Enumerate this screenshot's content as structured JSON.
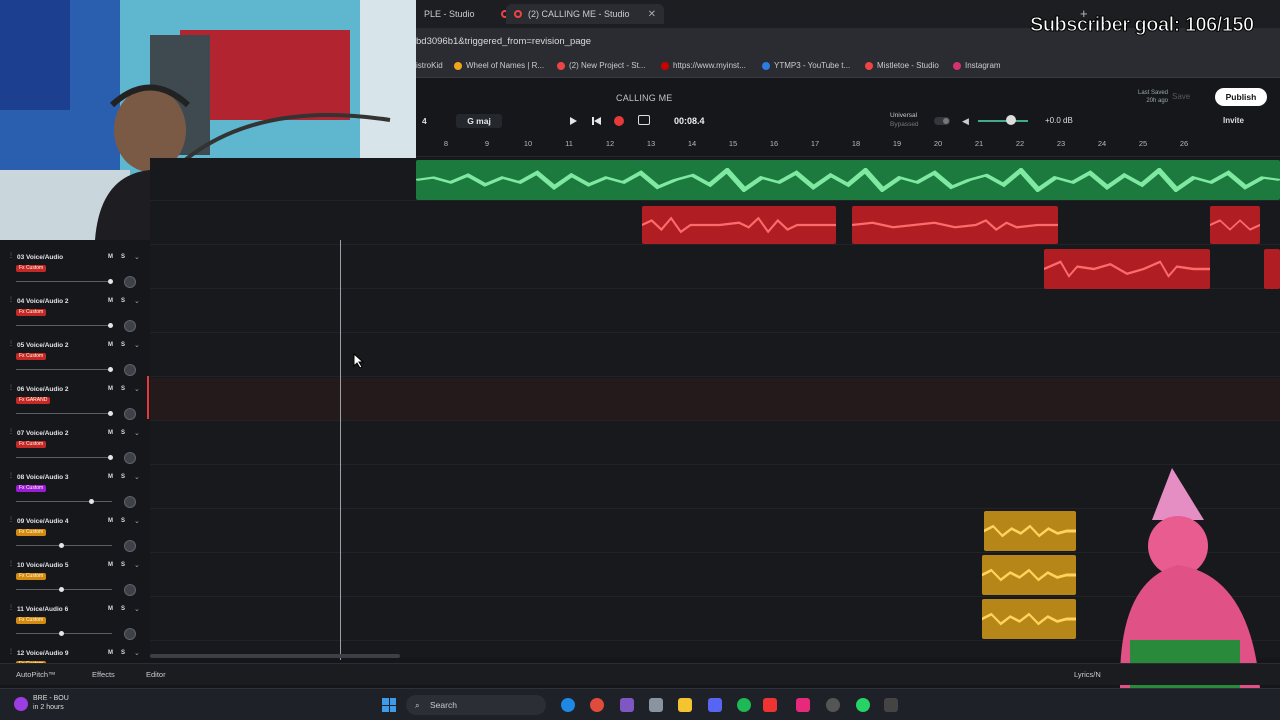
{
  "browser": {
    "tabs": [
      {
        "label": "PLE - Studio",
        "active": false
      },
      {
        "label": "(2) CALLING ME - Studio",
        "active": true
      }
    ],
    "address": "bd3096b1&triggered_from=revision_page",
    "bookmarks": [
      {
        "label": "istroKid",
        "color": "#6a6a6a"
      },
      {
        "label": "Wheel of Names | R...",
        "color": "#f2a51a"
      },
      {
        "label": "(2) New Project - St...",
        "color": "#e44"
      },
      {
        "label": "https://www.myinst...",
        "color": "#c00"
      },
      {
        "label": "YTMP3 - YouTube t...",
        "color": "#2a7de1"
      },
      {
        "label": "Mistletoe - Studio",
        "color": "#e44"
      },
      {
        "label": "Instagram",
        "color": "#d6336c"
      }
    ]
  },
  "overlay": {
    "subscriber_goal": "Subscriber goal: 106/150"
  },
  "studio": {
    "project_title": "CALLING ME",
    "bpm_fragment": "4",
    "key": "G maj",
    "time": "00:08.4",
    "universal_label": "Universal",
    "bypassed_label": "Bypassed",
    "gain": "+0.0 dB",
    "last_saved_label": "Last Saved",
    "last_saved_time": "20h ago",
    "save_label": "Save",
    "publish_label": "Publish",
    "invite_label": "Invite",
    "ruler_ticks": [
      "8",
      "9",
      "10",
      "11",
      "12",
      "13",
      "14",
      "15",
      "16",
      "17",
      "18",
      "19",
      "20",
      "21",
      "22",
      "23",
      "24",
      "25",
      "26"
    ],
    "tracks": [
      {
        "number": "03",
        "name": "Voice/Audio",
        "fx": "Fx Custom",
        "fx_color": "#c62828",
        "fader": 0.98,
        "selected": false
      },
      {
        "number": "04",
        "name": "Voice/Audio 2",
        "fx": "Fx Custom",
        "fx_color": "#c62828",
        "fader": 0.98,
        "selected": false
      },
      {
        "number": "05",
        "name": "Voice/Audio 2",
        "fx": "Fx Custom",
        "fx_color": "#c62828",
        "fader": 0.98,
        "selected": false
      },
      {
        "number": "06",
        "name": "Voice/Audio 2",
        "fx": "Fx GARAND",
        "fx_color": "#c62828",
        "fader": 0.98,
        "selected": true
      },
      {
        "number": "07",
        "name": "Voice/Audio 2",
        "fx": "Fx Custom",
        "fx_color": "#c62828",
        "fader": 0.98,
        "selected": false
      },
      {
        "number": "08",
        "name": "Voice/Audio 3",
        "fx": "Fx Custom",
        "fx_color": "#9b1bd8",
        "fader": 0.78,
        "selected": false
      },
      {
        "number": "09",
        "name": "Voice/Audio 4",
        "fx": "Fx Custom",
        "fx_color": "#d4890f",
        "fader": 0.47,
        "selected": false
      },
      {
        "number": "10",
        "name": "Voice/Audio 5",
        "fx": "Fx Custom",
        "fx_color": "#d4890f",
        "fader": 0.47,
        "selected": false
      },
      {
        "number": "11",
        "name": "Voice/Audio 6",
        "fx": "Fx Custom",
        "fx_color": "#d4890f",
        "fader": 0.47,
        "selected": false
      },
      {
        "number": "12",
        "name": "Voice/Audio 9",
        "fx": "Fx Custom",
        "fx_color": "#d4890f",
        "fader": 0.47,
        "selected": false
      }
    ],
    "mute_label": "M",
    "solo_label": "S",
    "bottom": {
      "autopitch": "AutoPitch™",
      "effects": "Effects",
      "editor": "Editor",
      "lyrics": "Lyrics/N"
    }
  },
  "taskbar": {
    "weather_title": "BRE - BOU",
    "weather_sub": "in 2 hours",
    "search_placeholder": "Search"
  },
  "colors": {
    "clip_red": "#b01d22",
    "clip_yellow": "#b78618",
    "clip_green": "#1c7a3f",
    "accent_red": "#e43a3a"
  }
}
